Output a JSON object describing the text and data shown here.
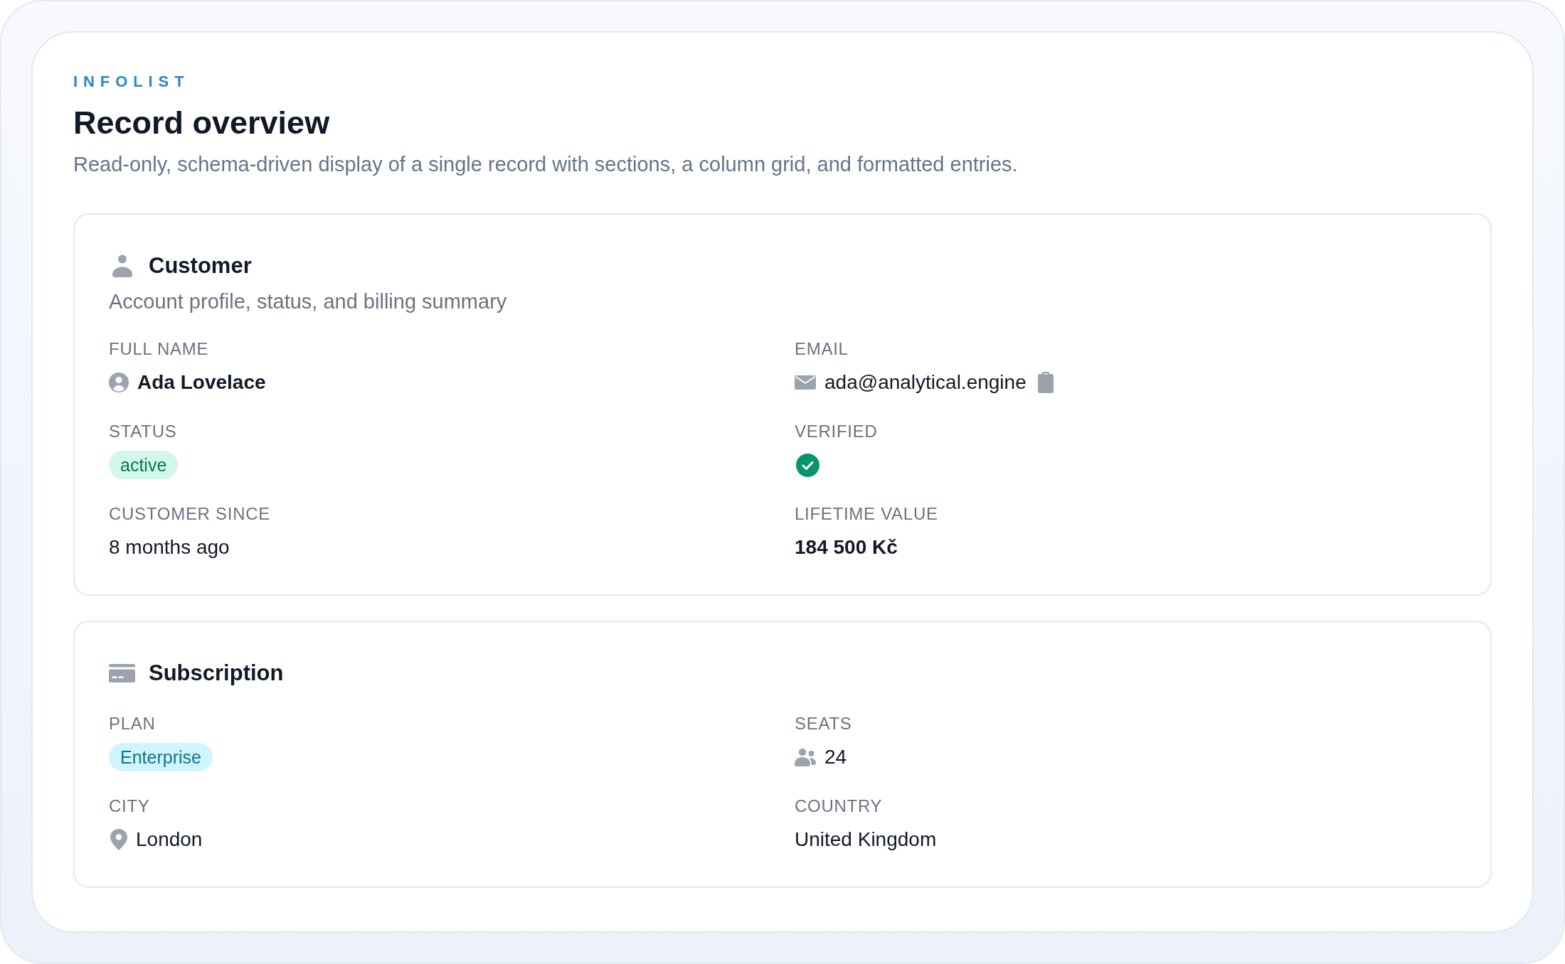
{
  "header": {
    "eyebrow": "INFOLIST",
    "title": "Record overview",
    "description": "Read-only, schema-driven display of a single record with sections, a column grid, and formatted entries."
  },
  "sections": [
    {
      "title": "Customer",
      "description": "Account profile, status, and billing summary",
      "entries": [
        {
          "label": "FULL NAME",
          "kind": "person",
          "value": "Ada Lovelace"
        },
        {
          "label": "EMAIL",
          "kind": "email",
          "value": "ada@analytical.engine",
          "copyable": true
        },
        {
          "label": "STATUS",
          "kind": "badge",
          "value": "active",
          "color": "#047857"
        },
        {
          "label": "VERIFIED",
          "kind": "boolean",
          "checked": true
        },
        {
          "label": "CUSTOMER SINCE",
          "kind": "text",
          "value": "8 months ago"
        },
        {
          "label": "LIFETIME VALUE",
          "kind": "money",
          "value": "184 500 Kč"
        }
      ]
    },
    {
      "title": "Subscription",
      "entries": [
        {
          "label": "PLAN",
          "kind": "badge",
          "value": "Enterprise",
          "color": "#0e7490"
        },
        {
          "label": "SEATS",
          "kind": "count",
          "value": "24"
        },
        {
          "label": "CITY",
          "kind": "location",
          "value": "London"
        },
        {
          "label": "COUNTRY",
          "kind": "text",
          "value": "United Kingdom"
        }
      ]
    }
  ]
}
